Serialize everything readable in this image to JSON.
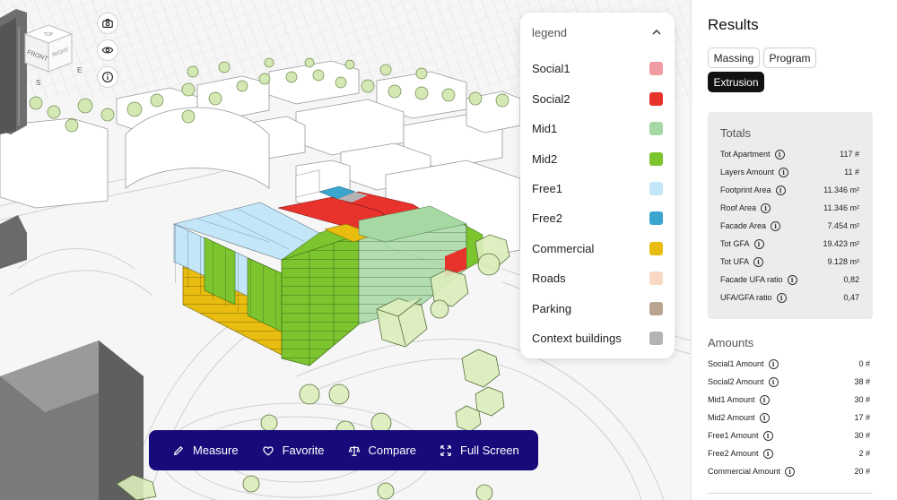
{
  "viewcube": {
    "top": "TOP",
    "front": "FRONT",
    "right": "RIGHT",
    "east": "E",
    "south": "S"
  },
  "viewport_tools": [
    {
      "name": "camera-icon"
    },
    {
      "name": "eye-icon"
    },
    {
      "name": "info-icon"
    }
  ],
  "legend": {
    "title": "legend",
    "items": [
      {
        "label": "Social1",
        "color": "#f19ba2"
      },
      {
        "label": "Social2",
        "color": "#e8322c"
      },
      {
        "label": "Mid1",
        "color": "#a6d8a4"
      },
      {
        "label": "Mid2",
        "color": "#7dc52f"
      },
      {
        "label": "Free1",
        "color": "#c3e6f8"
      },
      {
        "label": "Free2",
        "color": "#3aa5cf"
      },
      {
        "label": "Commercial",
        "color": "#e8bd10"
      },
      {
        "label": "Roads",
        "color": "#f8d8c2"
      },
      {
        "label": "Parking",
        "color": "#b8a48f"
      },
      {
        "label": "Context buildings",
        "color": "#b3b3b3"
      }
    ]
  },
  "toolbar": {
    "buttons": [
      {
        "label": "Measure",
        "icon": "pencil-icon"
      },
      {
        "label": "Favorite",
        "icon": "heart-icon"
      },
      {
        "label": "Compare",
        "icon": "scale-icon"
      },
      {
        "label": "Full Screen",
        "icon": "expand-icon"
      }
    ]
  },
  "results": {
    "title": "Results",
    "tabs": [
      {
        "label": "Massing",
        "active": false
      },
      {
        "label": "Program",
        "active": false
      },
      {
        "label": "Extrusion",
        "active": true
      }
    ],
    "totals_title": "Totals",
    "totals": [
      {
        "label": "Tot Apartment",
        "value": "117 #"
      },
      {
        "label": "Layers Amount",
        "value": "11 #"
      },
      {
        "label": "Footprint Area",
        "value": "11.346 m²"
      },
      {
        "label": "Roof Area",
        "value": "11.346 m²"
      },
      {
        "label": "Facade Area",
        "value": "7.454 m²"
      },
      {
        "label": "Tot GFA",
        "value": "19.423 m²"
      },
      {
        "label": "Tot UFA",
        "value": "9.128 m²"
      },
      {
        "label": "Facade UFA ratio",
        "value": "0,82"
      },
      {
        "label": "UFA/GFA ratio",
        "value": "0,47"
      }
    ],
    "amounts_title": "Amounts",
    "amounts": [
      {
        "label": "Social1 Amount",
        "value": "0 #"
      },
      {
        "label": "Social2 Amount",
        "value": "38 #"
      },
      {
        "label": "Mid1 Amount",
        "value": "30 #"
      },
      {
        "label": "Mid2 Amount",
        "value": "17 #"
      },
      {
        "label": "Free1 Amount",
        "value": "30 #"
      },
      {
        "label": "Free2 Amount",
        "value": "2 #"
      },
      {
        "label": "Commercial Amount",
        "value": "20 #"
      }
    ]
  }
}
